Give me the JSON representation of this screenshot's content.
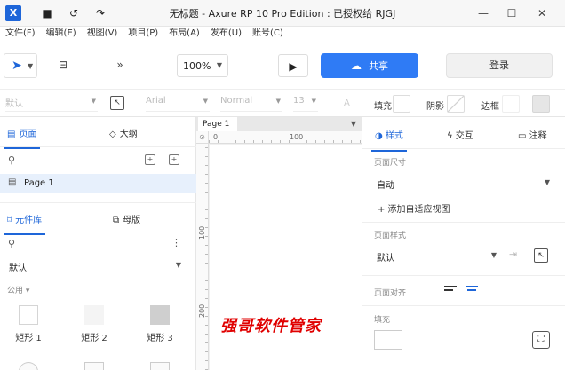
{
  "titlebar": {
    "app_icon": "X",
    "title": "无标题 - Axure RP 10 Pro Edition : 已授权给 RJGJ",
    "icons": [
      "save-icon",
      "undo-icon",
      "redo-icon"
    ],
    "window_controls": [
      "minimize-icon",
      "maximize-icon",
      "close-icon"
    ]
  },
  "menu": [
    "文件(F)",
    "编辑(E)",
    "视图(V)",
    "项目(P)",
    "布局(A)",
    "发布(U)",
    "账号(C)"
  ],
  "toolbar": {
    "zoom": "100%",
    "share_label": "共享",
    "login_label": "登录"
  },
  "formatbar": {
    "font_family": "默认",
    "font_name": "Arial",
    "font_weight": "Normal",
    "font_size": "13",
    "text_color_label": "A",
    "fill_label": "填充",
    "shadow_label": "阴影",
    "border_label": "边框"
  },
  "left_panel": {
    "pages_tab": "页面",
    "outline_tab": "大纲",
    "page_item": "Page 1",
    "library_tab": "元件库",
    "masters_tab": "母版",
    "library_select": "默认",
    "group_label": "公用 ▾",
    "widgets": [
      "矩形 1",
      "矩形 2",
      "矩形 3"
    ]
  },
  "canvas": {
    "page_tab": "Page 1",
    "ruler_h": [
      "0",
      "100"
    ],
    "ruler_v": [
      "100",
      "200"
    ],
    "watermark": "强哥软件管家"
  },
  "right_panel": {
    "style_tab": "样式",
    "interaction_tab": "交互",
    "notes_tab": "注释",
    "page_size_label": "页面尺寸",
    "page_size_value": "自动",
    "adaptive_link": "+ 添加自适应视图",
    "page_style_label": "页面样式",
    "page_style_value": "默认",
    "page_align_label": "页面对齐",
    "fill_label": "填充"
  },
  "colors": {
    "accent": "#2f7bf5",
    "selected_row": "#e7f0fc",
    "watermark": "#e00000"
  }
}
